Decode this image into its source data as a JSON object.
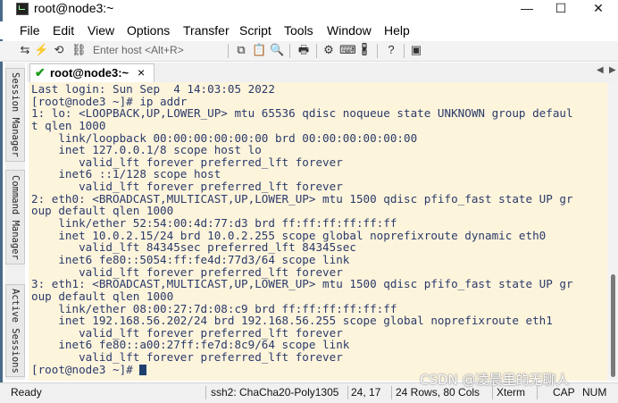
{
  "window": {
    "title": "root@node3:~",
    "controls": {
      "minimize": "—",
      "maximize": "☐",
      "close": "✕"
    }
  },
  "menu": [
    "File",
    "Edit",
    "View",
    "Options",
    "Transfer",
    "Script",
    "Tools",
    "Window",
    "Help"
  ],
  "toolbar": {
    "host_placeholder": "Enter host <Alt+R>"
  },
  "sidebar": {
    "tabs": [
      "Session Manager",
      "Command Manager",
      "Active Sessions"
    ]
  },
  "tab": {
    "label": "root@node3:~",
    "close": "×",
    "arrow_left": "◀",
    "arrow_right": "▶"
  },
  "terminal": {
    "lines": [
      "Last login: Sun Sep  4 14:03:05 2022",
      "[root@node3 ~]# ip addr",
      "1: lo: <LOOPBACK,UP,LOWER_UP> mtu 65536 qdisc noqueue state UNKNOWN group defaul",
      "t qlen 1000",
      "    link/loopback 00:00:00:00:00:00 brd 00:00:00:00:00:00",
      "    inet 127.0.0.1/8 scope host lo",
      "       valid_lft forever preferred_lft forever",
      "    inet6 ::1/128 scope host",
      "       valid_lft forever preferred_lft forever",
      "2: eth0: <BROADCAST,MULTICAST,UP,LOWER_UP> mtu 1500 qdisc pfifo_fast state UP gr",
      "oup default qlen 1000",
      "    link/ether 52:54:00:4d:77:d3 brd ff:ff:ff:ff:ff:ff",
      "    inet 10.0.2.15/24 brd 10.0.2.255 scope global noprefixroute dynamic eth0",
      "       valid_lft 84345sec preferred_lft 84345sec",
      "    inet6 fe80::5054:ff:fe4d:77d3/64 scope link",
      "       valid_lft forever preferred_lft forever",
      "3: eth1: <BROADCAST,MULTICAST,UP,LOWER_UP> mtu 1500 qdisc pfifo_fast state UP gr",
      "oup default qlen 1000",
      "    link/ether 08:00:27:7d:08:c9 brd ff:ff:ff:ff:ff:ff",
      "    inet 192.168.56.202/24 brd 192.168.56.255 scope global noprefixroute eth1",
      "       valid_lft forever preferred_lft forever",
      "    inet6 fe80::a00:27ff:fe7d:8c9/64 scope link",
      "       valid_lft forever preferred_lft forever"
    ],
    "prompt": "[root@node3 ~]# "
  },
  "status": {
    "ready": "Ready",
    "cipher": "ssh2: ChaCha20-Poly1305",
    "cursor": "24, 17",
    "size": "24 Rows, 80 Cols",
    "term": "Xterm",
    "caps": "CAP",
    "num": "NUM"
  },
  "watermark": "CSDN @凌晨里的无聊人",
  "colors": {
    "terminal_bg": "#fdf4dc",
    "terminal_fg": "#2a3a6a",
    "tab_check": "#1a9a1a"
  }
}
